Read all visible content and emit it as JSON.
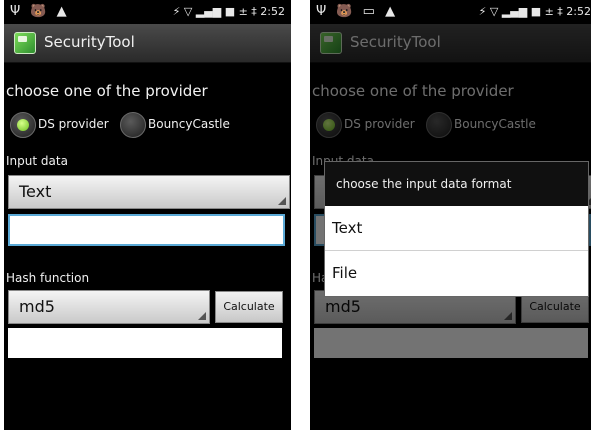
{
  "status_bar": {
    "left_icons": "Ψ 🐻 ▲",
    "left_icons_right": "Ψ 🐻 ▭ ▲",
    "right_icons": "⚡ ▽ ▂▄▆ ■ ± ‡",
    "time": "2:52"
  },
  "app": {
    "title": "SecurityTool",
    "icon": "app-icon"
  },
  "provider": {
    "prompt": "choose one of the provider",
    "options": [
      "DS provider",
      "BouncyCastle"
    ],
    "selected": "DS provider"
  },
  "input_section": {
    "label": "Input data",
    "format_value": "Text",
    "text_value": ""
  },
  "hash_section": {
    "label": "Hash function",
    "function_value": "md5",
    "calculate_label": "Calculate",
    "result_value": ""
  },
  "dialog": {
    "title": "choose the input data format",
    "options": [
      "Text",
      "File"
    ]
  },
  "colors": {
    "accent": "#5aa9d6",
    "radio_on": "#8fdc3a",
    "titlebar": "#3a3a3a"
  }
}
